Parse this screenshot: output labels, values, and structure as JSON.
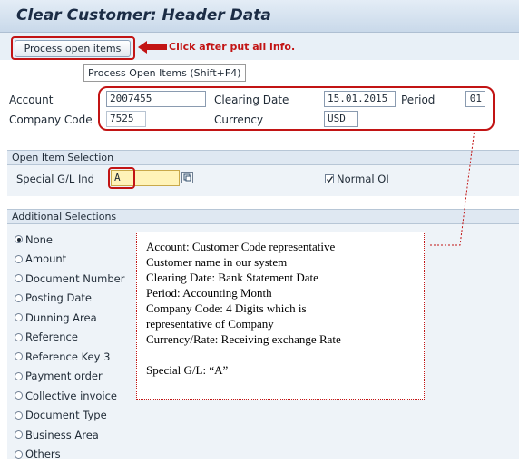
{
  "window": {
    "title": "Clear Customer: Header Data"
  },
  "toolbar": {
    "process_button_label": "Process open items",
    "callout": "Click after put all info.",
    "tooltip": "Process Open Items  (Shift+F4)"
  },
  "header_fields": {
    "account_label": "Account",
    "account_value": "2007455",
    "clearing_date_label": "Clearing Date",
    "clearing_date_value": "15.01.2015",
    "period_label": "Period",
    "period_value": "01",
    "company_code_label": "Company Code",
    "company_code_value": "7525",
    "currency_label": "Currency",
    "currency_value": "USD"
  },
  "open_item_selection": {
    "title": "Open Item Selection",
    "special_gl_label": "Special G/L Ind",
    "special_gl_value": "A",
    "normal_oi_label": "Normal OI",
    "normal_oi_checked": true
  },
  "additional_selections": {
    "title": "Additional Selections",
    "options": [
      {
        "label": "None",
        "selected": true
      },
      {
        "label": "Amount",
        "selected": false
      },
      {
        "label": "Document Number",
        "selected": false
      },
      {
        "label": "Posting Date",
        "selected": false
      },
      {
        "label": "Dunning Area",
        "selected": false
      },
      {
        "label": "Reference",
        "selected": false
      },
      {
        "label": "Reference Key 3",
        "selected": false
      },
      {
        "label": "Payment order",
        "selected": false
      },
      {
        "label": "Collective invoice",
        "selected": false
      },
      {
        "label": "Document Type",
        "selected": false
      },
      {
        "label": "Business Area",
        "selected": false
      },
      {
        "label": "Others",
        "selected": false
      }
    ]
  },
  "annotation_note": {
    "lines": [
      "Account: Customer Code representative",
      "Customer name in our system",
      "Clearing Date: Bank Statement Date",
      "Period: Accounting Month",
      "Company Code: 4 Digits which is",
      "representative of Company",
      "Currency/Rate: Receiving exchange Rate",
      "",
      "Special G/L: “A”"
    ]
  },
  "colors": {
    "annotation_red": "#c21414",
    "header_bar": "#c9d9ea",
    "group_header": "#dfe8f2",
    "highlight_field": "#fff3b8"
  },
  "icons": {
    "callout_arrow": "arrow-left-icon",
    "search_help": "search-help-icon",
    "checkmark": "checkmark-icon"
  }
}
